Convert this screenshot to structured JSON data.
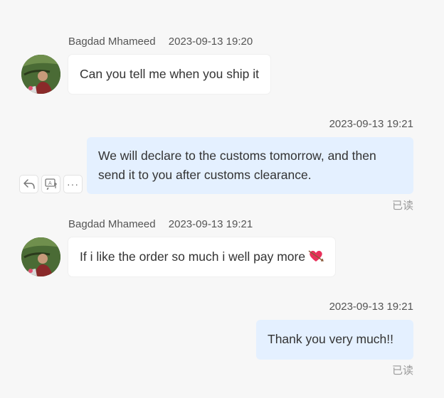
{
  "messages": [
    {
      "sender": "Bagdad Mhameed",
      "time": "2023-09-13 19:20",
      "text": "Can you tell me when you ship it"
    },
    {
      "time": "2023-09-13 19:21",
      "text_line1": "We will declare to the customs tomorrow, and then",
      "text_line2": "send it to you after customs clearance.",
      "status": "已读"
    },
    {
      "sender": "Bagdad Mhameed",
      "time": "2023-09-13 19:21",
      "text": "If i like the order so much i well pay more",
      "emoji": "heart-with-arrow"
    },
    {
      "time": "2023-09-13 19:21",
      "text": "Thank you very much!!",
      "status": "已读"
    }
  ],
  "message_actions": {
    "icons": [
      "reply-icon",
      "translate-icon",
      "more-icon"
    ],
    "more_label": "···"
  },
  "colors": {
    "background": "#f7f7f7",
    "incoming_bubble": "#ffffff",
    "outgoing_bubble": "#e4f0ff",
    "read_status": "#9a9a9a",
    "heart": "#e8315b"
  }
}
